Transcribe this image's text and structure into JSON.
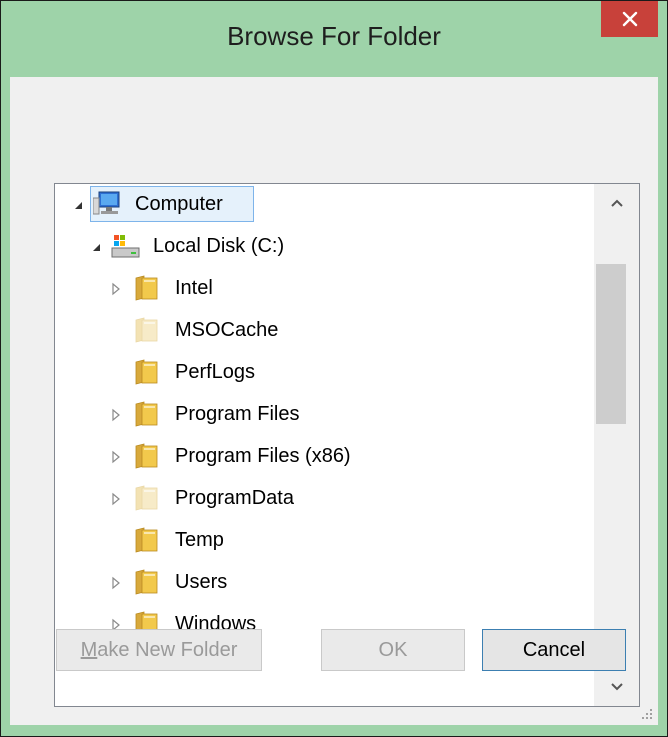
{
  "window": {
    "title": "Browse For Folder"
  },
  "tree": {
    "items": [
      {
        "label": "Computer",
        "level": 0,
        "expander": "expanded",
        "icon": "computer-icon",
        "selected": true
      },
      {
        "label": "Local Disk (C:)",
        "level": 1,
        "expander": "expanded",
        "icon": "drive-icon"
      },
      {
        "label": "Intel",
        "level": 2,
        "expander": "collapsed",
        "icon": "folder-icon"
      },
      {
        "label": "MSOCache",
        "level": 2,
        "expander": "none",
        "icon": "folder-faded-icon"
      },
      {
        "label": "PerfLogs",
        "level": 2,
        "expander": "none",
        "icon": "folder-icon"
      },
      {
        "label": "Program Files",
        "level": 2,
        "expander": "collapsed",
        "icon": "folder-icon"
      },
      {
        "label": "Program Files (x86)",
        "level": 2,
        "expander": "collapsed",
        "icon": "folder-icon"
      },
      {
        "label": "ProgramData",
        "level": 2,
        "expander": "collapsed",
        "icon": "folder-faded-icon"
      },
      {
        "label": "Temp",
        "level": 2,
        "expander": "none",
        "icon": "folder-icon"
      },
      {
        "label": "Users",
        "level": 2,
        "expander": "collapsed",
        "icon": "folder-icon"
      },
      {
        "label": "Windows",
        "level": 2,
        "expander": "collapsed",
        "icon": "folder-icon"
      }
    ]
  },
  "buttons": {
    "make_new_folder_mnemonic": "M",
    "make_new_folder_rest": "ake New Folder",
    "ok": "OK",
    "cancel": "Cancel"
  },
  "colors": {
    "frame": "#9ed3a9",
    "close": "#c8413a",
    "selection_border": "#7eb4ea",
    "selection_fill": "#e5f1fb"
  }
}
